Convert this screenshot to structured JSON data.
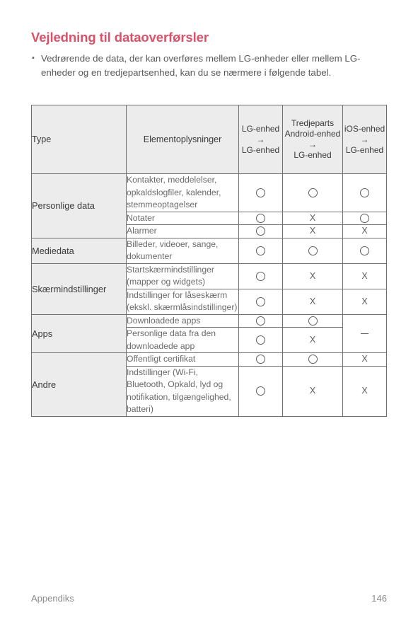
{
  "document": {
    "title": "Vejledning til dataoverførsler",
    "title_color": "#d9526a",
    "bullets": [
      "Vedrørende de data, der kan overføres mellem LG-enheder eller mellem LG-enheder og en tredjepartsenhed, kan du se nærmere i følgende tabel."
    ],
    "bullet_marker": "▪"
  },
  "table": {
    "headers": {
      "type": "Type",
      "detail": "Elementoplysninger",
      "lg": {
        "from": "LG-enhed",
        "arrow": "→",
        "to": "LG-enhed"
      },
      "android": {
        "from": "Tredjeparts Android-enhed",
        "arrow": "→",
        "to": "LG-enhed"
      },
      "ios": {
        "from": "iOS-enhed",
        "arrow": "→",
        "to": "LG-enhed"
      }
    },
    "symbols": {
      "yes": "○",
      "no": "X",
      "na": "–"
    },
    "groups": [
      {
        "type": "Personlige data",
        "rows": [
          {
            "detail": "Kontakter, meddelelser, opkaldslogfiler, kalender, stemmeoptagelser",
            "lg": "○",
            "android": "○",
            "ios": "○"
          },
          {
            "detail": "Notater",
            "lg": "○",
            "android": "X",
            "ios": "○"
          },
          {
            "detail": "Alarmer",
            "lg": "○",
            "android": "X",
            "ios": "X"
          }
        ]
      },
      {
        "type": "Mediedata",
        "rows": [
          {
            "detail": "Billeder, videoer, sange, dokumenter",
            "lg": "○",
            "android": "○",
            "ios": "○"
          }
        ]
      },
      {
        "type": "Skærmindstillinger",
        "rows": [
          {
            "detail": "Startskærmindstillinger (mapper og widgets)",
            "lg": "○",
            "android": "X",
            "ios": "X"
          },
          {
            "detail": "Indstillinger for låseskærm (ekskl. skærmlåsindstillinger)",
            "lg": "○",
            "android": "X",
            "ios": "X"
          }
        ]
      },
      {
        "type": "Apps",
        "ios_merged": "–",
        "rows": [
          {
            "detail": "Downloadede apps",
            "lg": "○",
            "android": "○"
          },
          {
            "detail": "Personlige data fra den downloadede app",
            "lg": "○",
            "android": "X"
          }
        ]
      },
      {
        "type": "Andre",
        "rows": [
          {
            "detail": "Offentligt certifikat",
            "lg": "○",
            "android": "○",
            "ios": "X"
          },
          {
            "detail": "Indstillinger (Wi-Fi, Bluetooth, Opkald, lyd og notifikation, tilgængelighed, batteri)",
            "lg": "○",
            "android": "X",
            "ios": "X"
          }
        ]
      }
    ]
  },
  "footer": {
    "section": "Appendiks",
    "page_number": "146"
  }
}
